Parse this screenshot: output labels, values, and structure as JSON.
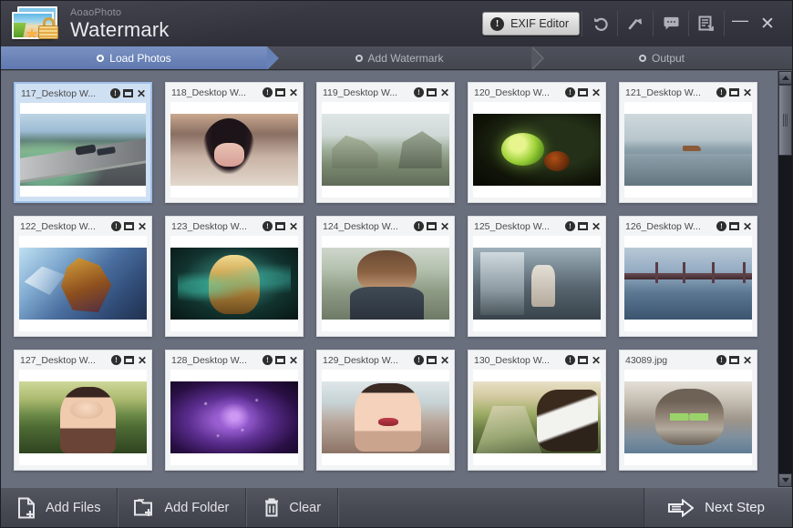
{
  "app": {
    "brand_sub": "AoaoPhoto",
    "brand_main": "Watermark",
    "logo_icon": "photo-stack-lock-icon"
  },
  "titlebar": {
    "exif_button": {
      "label": "EXIF Editor",
      "icon": "info-exclamation-icon"
    },
    "icons": [
      {
        "name": "undo-icon",
        "tooltip": "Undo"
      },
      {
        "name": "redo-arrow-icon",
        "tooltip": "Redo"
      },
      {
        "name": "comment-icon",
        "tooltip": "Feedback"
      },
      {
        "name": "register-document-icon",
        "tooltip": "Register"
      }
    ],
    "minimize_label": "—",
    "close_label": "✕"
  },
  "steps": [
    {
      "label": "Load Photos",
      "active": true
    },
    {
      "label": "Add Watermark",
      "active": false
    },
    {
      "label": "Output",
      "active": false
    }
  ],
  "gallery": {
    "item_icons": {
      "info": "info-icon",
      "maximize": "maximize-icon",
      "close": "close-icon"
    },
    "items": [
      {
        "title": "117_Desktop W...",
        "art": "t117",
        "selected": true
      },
      {
        "title": "118_Desktop W...",
        "art": "t118",
        "selected": false
      },
      {
        "title": "119_Desktop W...",
        "art": "t119",
        "selected": false
      },
      {
        "title": "120_Desktop W...",
        "art": "t120",
        "selected": false
      },
      {
        "title": "121_Desktop W...",
        "art": "t121",
        "selected": false
      },
      {
        "title": "122_Desktop W...",
        "art": "t122",
        "selected": false
      },
      {
        "title": "123_Desktop W...",
        "art": "t123",
        "selected": false
      },
      {
        "title": "124_Desktop W...",
        "art": "t124",
        "selected": false
      },
      {
        "title": "125_Desktop W...",
        "art": "t125",
        "selected": false
      },
      {
        "title": "126_Desktop W...",
        "art": "t126",
        "selected": false
      },
      {
        "title": "127_Desktop W...",
        "art": "t127",
        "selected": false
      },
      {
        "title": "128_Desktop W...",
        "art": "t128",
        "selected": false
      },
      {
        "title": "129_Desktop W...",
        "art": "t129",
        "selected": false
      },
      {
        "title": "130_Desktop W...",
        "art": "t130",
        "selected": false
      },
      {
        "title": "43089.jpg",
        "art": "t43089",
        "selected": false
      }
    ]
  },
  "scrollbar": {
    "up_arrow": "scroll-up-icon",
    "down_arrow": "scroll-down-icon"
  },
  "bottombar": {
    "add_files": {
      "label": "Add Files",
      "icon": "file-add-icon"
    },
    "add_folder": {
      "label": "Add Folder",
      "icon": "folder-add-icon"
    },
    "clear": {
      "label": "Clear",
      "icon": "trash-icon"
    },
    "next_step": {
      "label": "Next Step",
      "icon": "arrow-right-icon"
    }
  },
  "colors": {
    "accent_blue": "#6682b6",
    "background_slate": "#6a6f7e",
    "titlebar_dark": "#35363f",
    "selected_card": "#cfe0f3"
  }
}
